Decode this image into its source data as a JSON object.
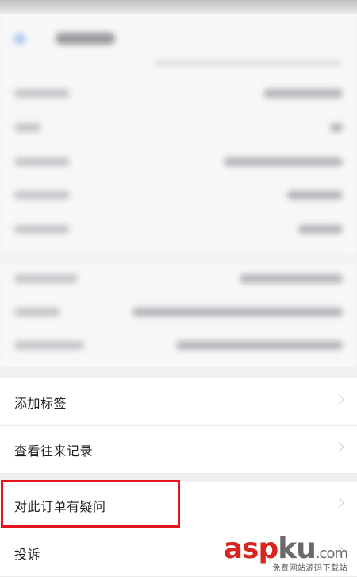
{
  "action_sheet": {
    "items": [
      {
        "label": "添加标签"
      },
      {
        "label": "查看往来记录"
      },
      {
        "label": "对此订单有疑问"
      },
      {
        "label": "投诉"
      }
    ]
  },
  "watermark": {
    "brand_red": "asp",
    "brand_gray": "ku",
    "domain_suffix": ".com",
    "tagline": "免费网站源码下载站"
  },
  "colors": {
    "highlight": "#e6141e",
    "watermark_red": "#d9251d",
    "watermark_gray": "#6a6a6a"
  }
}
